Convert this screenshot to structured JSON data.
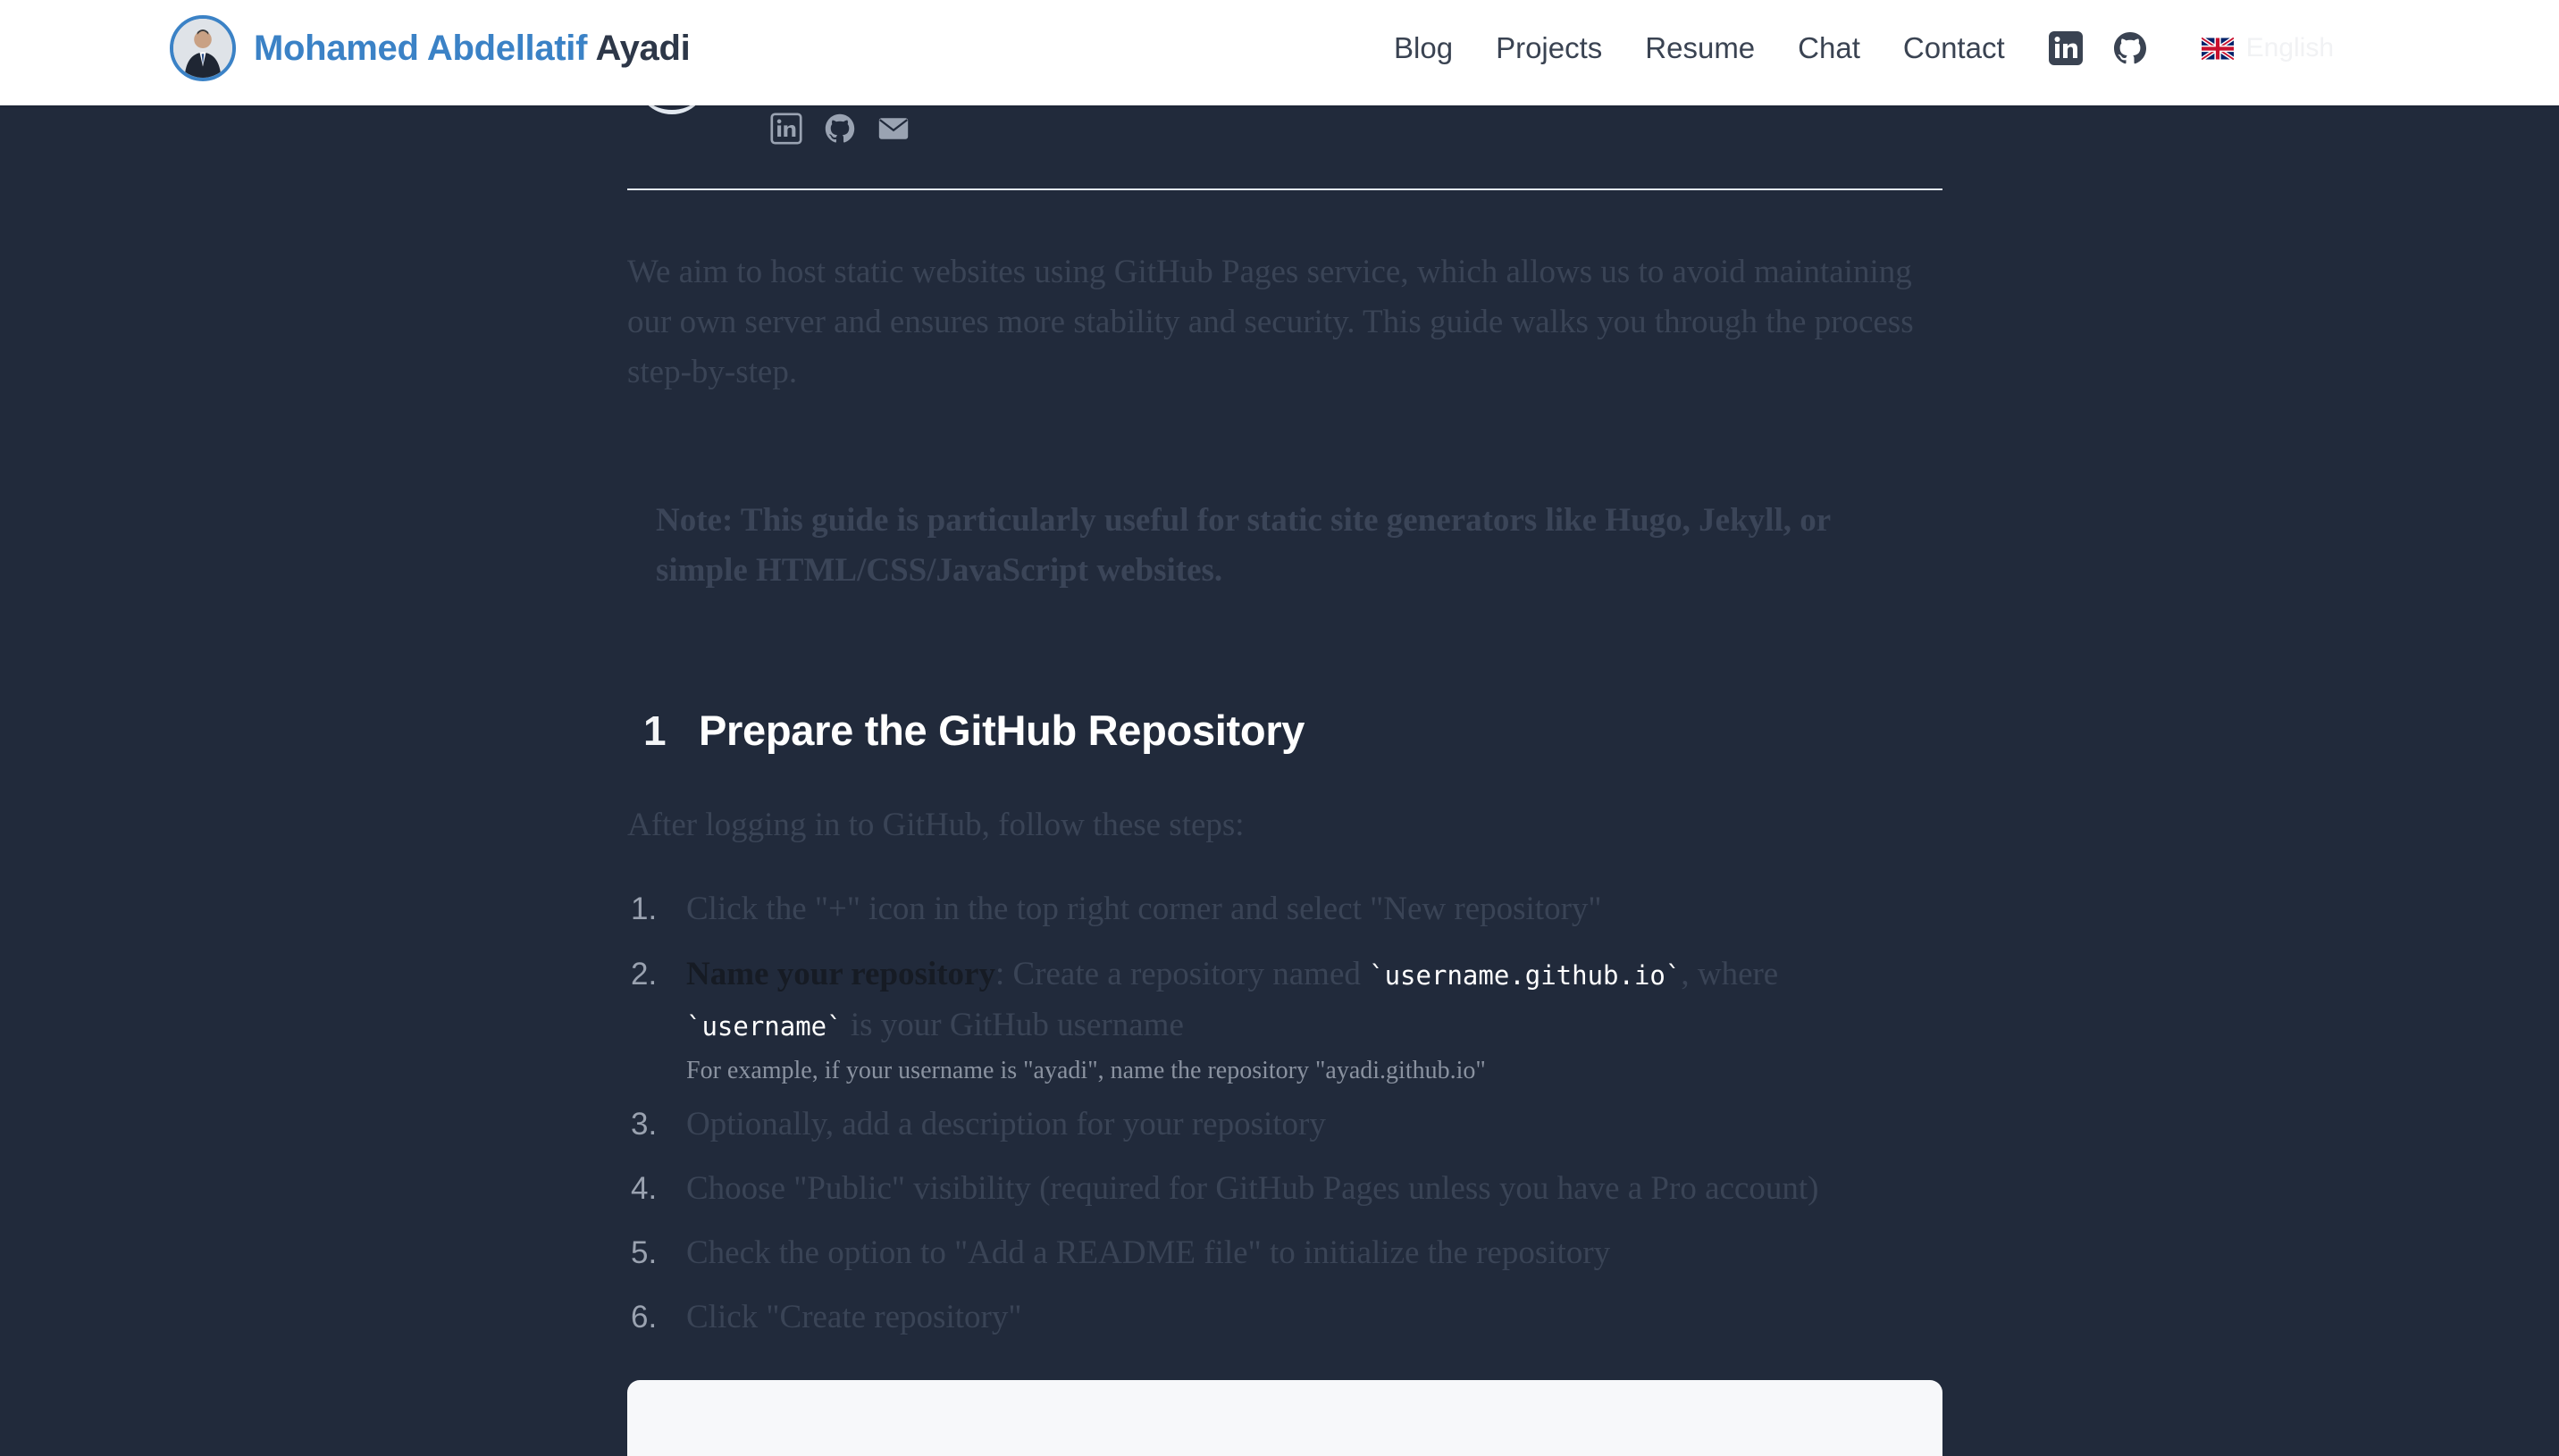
{
  "header": {
    "brand_first": "Mohamed Abdellatif",
    "brand_last": "Ayadi",
    "nav": [
      "Blog",
      "Projects",
      "Resume",
      "Chat",
      "Contact"
    ],
    "icons": [
      "linkedin-icon",
      "github-icon"
    ],
    "language": "English",
    "language_flag": "uk-flag-icon"
  },
  "author": {
    "social_icons": [
      "linkedin-icon",
      "github-icon",
      "envelope-icon"
    ]
  },
  "article": {
    "intro": "We aim to host static websites using GitHub Pages service, which allows us to avoid maintaining our own server and ensures more stability and security. This guide walks you through the process step-by-step.",
    "note_label": "Note:",
    "note_text": "This guide is particularly useful for static site generators like Hugo, Jekyll, or simple HTML/CSS/JavaScript websites.",
    "section": {
      "number": "1",
      "title": "Prepare the GitHub Repository",
      "intro": "After logging in to GitHub, follow these steps:"
    },
    "steps": [
      {
        "num": "1.",
        "text": "Click the \"+\" icon in the top right corner and select \"New repository\""
      },
      {
        "num": "2.",
        "strong": "Name your repository",
        "text_a": ": Create a repository named ",
        "code_a": "`username.github.io`",
        "text_b": ", where ",
        "code_b": "`username`",
        "text_c": " is your GitHub username",
        "example": "For example, if your username is \"ayadi\", name the repository \"ayadi.github.io\""
      },
      {
        "num": "3.",
        "text": "Optionally, add a description for your repository"
      },
      {
        "num": "4.",
        "text": "Choose \"Public\" visibility (required for GitHub Pages unless you have a Pro account)"
      },
      {
        "num": "5.",
        "text": "Check the option to \"Add a README file\" to initialize the repository"
      },
      {
        "num": "6.",
        "text": "Click \"Create repository\""
      }
    ]
  },
  "colors": {
    "background": "#212a3b",
    "brand_accent": "#3b82c6",
    "header_bg": "#ffffff"
  }
}
